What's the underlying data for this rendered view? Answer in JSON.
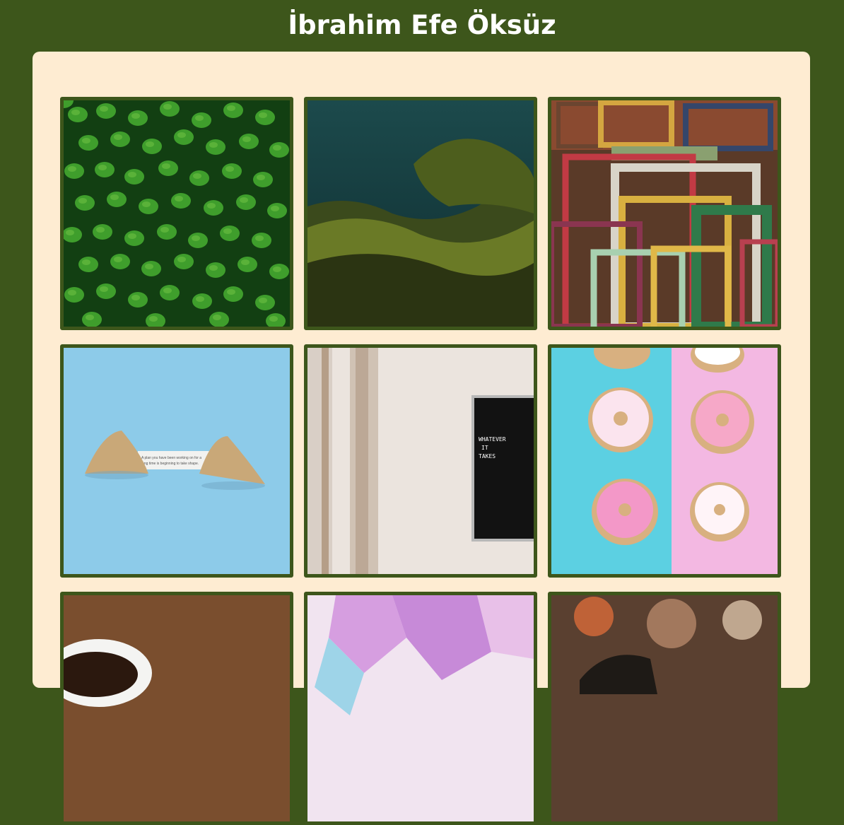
{
  "header": {
    "title": "İbrahim Efe Öksüz"
  },
  "gallery": {
    "photos": [
      {
        "subject": "green-leaves"
      },
      {
        "subject": "shrubs-over-water"
      },
      {
        "subject": "colorful-picture-frames"
      },
      {
        "subject": "fortune-cookie"
      },
      {
        "subject": "letter-board-on-wall"
      },
      {
        "subject": "donuts"
      },
      {
        "subject": "coffee-beans-cup"
      },
      {
        "subject": "pink-crystals"
      },
      {
        "subject": "blurred-bar-scene"
      }
    ],
    "letter_board_lines": [
      "WHATEVER",
      "IT",
      "TAKES"
    ],
    "fortune_slip_lines": [
      "A plan you have been working on for a",
      "long time is beginning to take shape."
    ]
  },
  "colors": {
    "background": "#3d561b",
    "card": "#feecd2",
    "photo_border": "#3d561b"
  }
}
